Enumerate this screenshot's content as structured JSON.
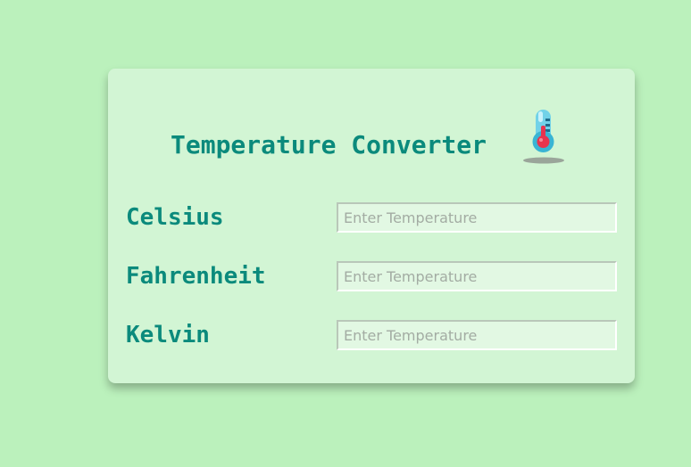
{
  "title": "Temperature Converter",
  "title_icon": "thermometer-icon",
  "colors": {
    "page_background": "#bbf1bc",
    "card_background": "#d2f5d4",
    "accent_text": "#0b8a7c",
    "input_background": "#e2f8e3"
  },
  "fields": {
    "celsius": {
      "label": "Celsius",
      "value": "",
      "placeholder": "Enter Temperature"
    },
    "fahrenheit": {
      "label": "Fahrenheit",
      "value": "",
      "placeholder": "Enter Temperature"
    },
    "kelvin": {
      "label": "Kelvin",
      "value": "",
      "placeholder": "Enter Temperature"
    }
  }
}
